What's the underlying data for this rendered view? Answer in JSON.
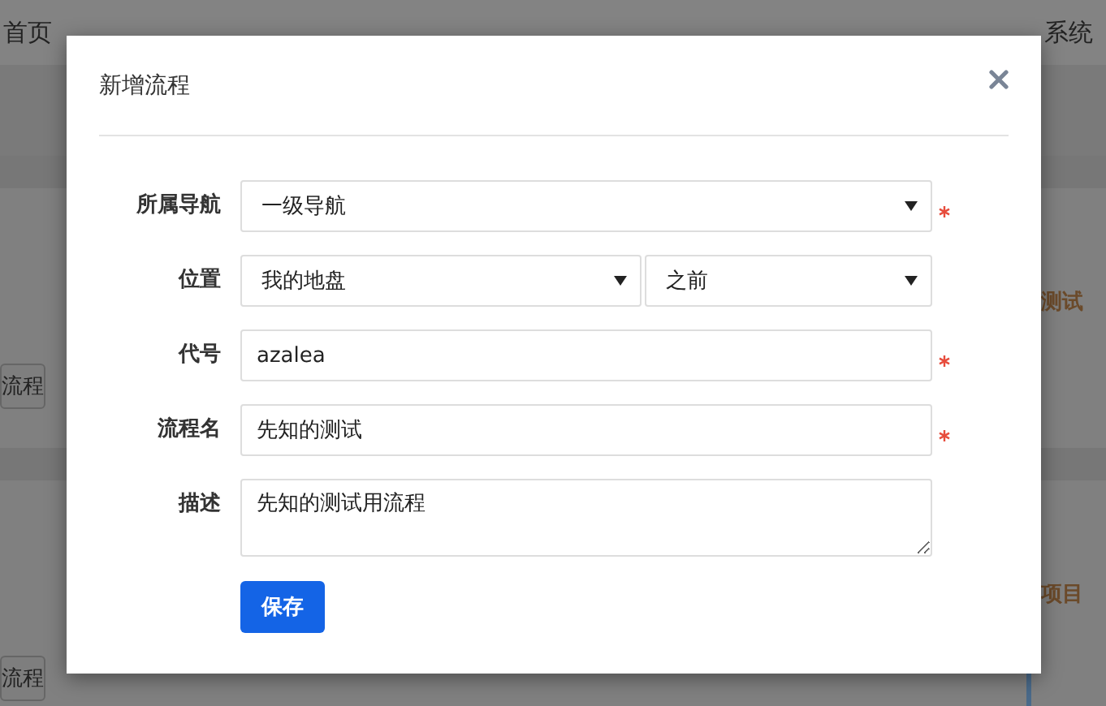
{
  "nav": {
    "items": [
      {
        "label": "首页",
        "selected": false
      },
      {
        "label": "系统",
        "selected": false
      }
    ]
  },
  "background": {
    "sections": [
      {
        "button": "流程",
        "label": "测试"
      },
      {
        "button": "流程",
        "label": "项目"
      }
    ]
  },
  "dialog": {
    "title": "新增流程",
    "fields": [
      {
        "kind": "select",
        "label": "所属导航",
        "value": "一级导航",
        "required": true
      },
      {
        "kind": "select-pair",
        "label": "位置",
        "values": [
          "我的地盘",
          "之前"
        ],
        "required": false
      },
      {
        "kind": "input",
        "label": "代号",
        "value": "azalea",
        "required": true
      },
      {
        "kind": "input",
        "label": "流程名",
        "value": "先知的测试",
        "required": true
      },
      {
        "kind": "textarea",
        "label": "描述",
        "value": "先知的测试用流程",
        "required": false
      }
    ],
    "submit": "保存"
  }
}
